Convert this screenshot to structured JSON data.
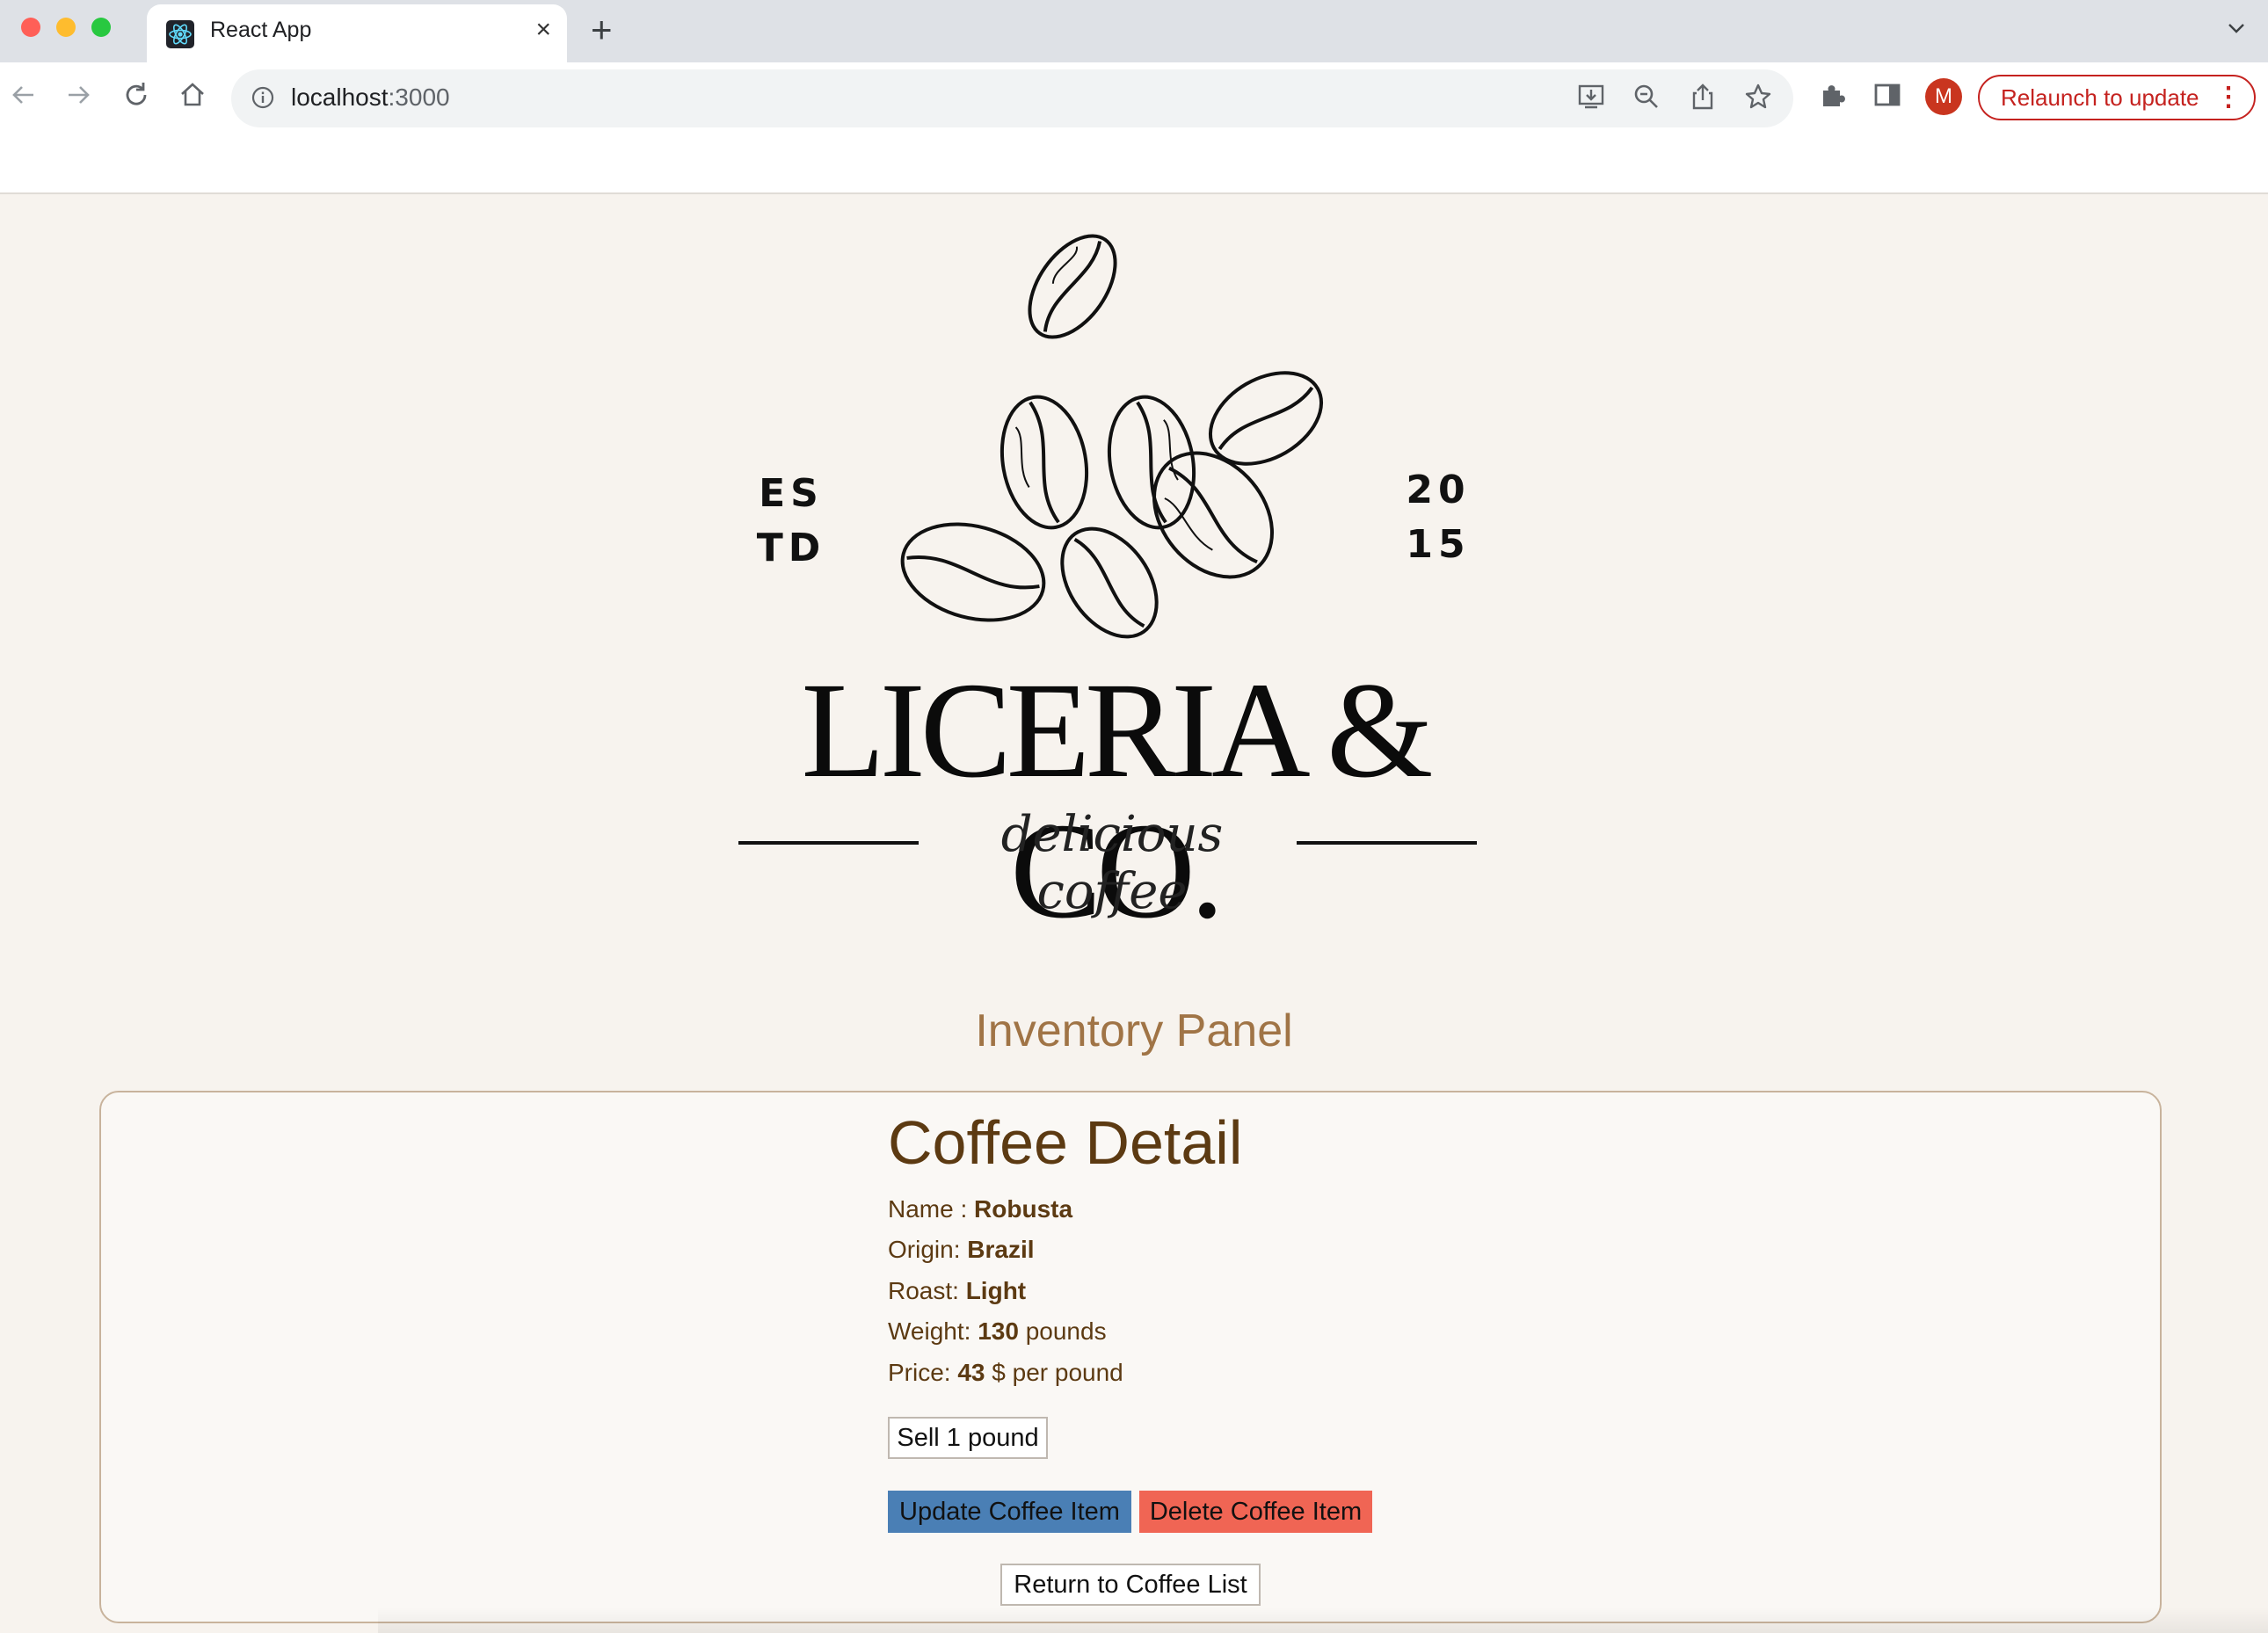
{
  "browser": {
    "tab_title": "React App",
    "tab_close": "×",
    "new_tab": "+",
    "url_host": "localhost",
    "url_port": ":3000",
    "profile_initial": "M",
    "relaunch_label": "Relaunch to update",
    "menu_dots": "⋮"
  },
  "logo": {
    "est_left": [
      "ES",
      "TD"
    ],
    "est_right": [
      "20",
      "15"
    ],
    "brand": "LICERIA & CO.",
    "tagline": "delicious coffee"
  },
  "page": {
    "panel_title": "Inventory Panel"
  },
  "coffee_detail": {
    "title": "Coffee Detail",
    "name_label": "Name : ",
    "name_value": "Robusta",
    "origin_label": "Origin: ",
    "origin_value": "Brazil",
    "roast_label": "Roast: ",
    "roast_value": "Light",
    "weight_label": "Weight: ",
    "weight_value": "130",
    "weight_unit": " pounds",
    "price_label": "Price: ",
    "price_value": "43",
    "price_unit": " $ per pound",
    "sell_button": "Sell 1 pound",
    "update_button": "Update Coffee Item",
    "delete_button": "Delete Coffee Item",
    "return_button": "Return to Coffee List"
  },
  "colors": {
    "accent_title": "#a07446",
    "detail_text": "#5c3a12",
    "update_button": "#4a7fb5",
    "delete_button": "#f06554",
    "relaunch": "#c5221f"
  }
}
